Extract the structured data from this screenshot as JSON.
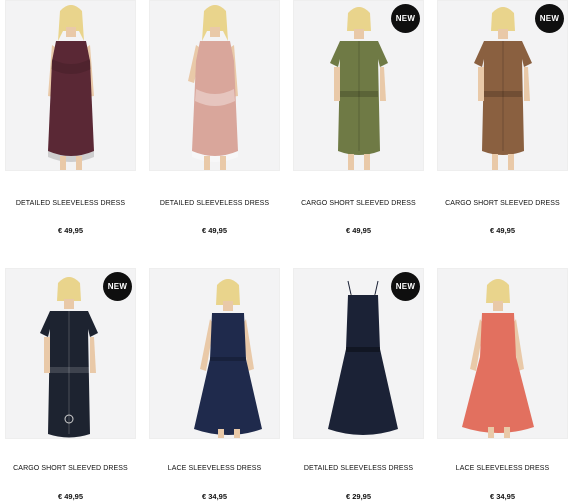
{
  "products": [
    {
      "name": "DETAILED SLEEVELESS DRESS",
      "price": "€ 49,95",
      "badge": "",
      "color": "#5a2835",
      "style": "cami-lace"
    },
    {
      "name": "DETAILED SLEEVELESS DRESS",
      "price": "€ 49,95",
      "badge": "",
      "color": "#d9a69b",
      "style": "cami-lace"
    },
    {
      "name": "CARGO SHORT SLEEVED DRESS",
      "price": "€ 49,95",
      "badge": "NEW",
      "color": "#6f7a45",
      "style": "shirt"
    },
    {
      "name": "CARGO SHORT SLEEVED DRESS",
      "price": "€ 49,95",
      "badge": "NEW",
      "color": "#8a6040",
      "style": "shirt"
    },
    {
      "name": "CARGO SHORT SLEEVED DRESS",
      "price": "€ 49,95",
      "badge": "NEW",
      "color": "#1d2330",
      "style": "shirt"
    },
    {
      "name": "LACE SLEEVELESS DRESS",
      "price": "€ 34,95",
      "badge": "",
      "color": "#1f2a4c",
      "style": "skater"
    },
    {
      "name": "DETAILED SLEEVELESS DRESS",
      "price": "€ 29,95",
      "badge": "NEW",
      "color": "#1b2236",
      "style": "strappy"
    },
    {
      "name": "LACE SLEEVELESS DRESS",
      "price": "€ 34,95",
      "badge": "",
      "color": "#e2705f",
      "style": "skater"
    }
  ]
}
